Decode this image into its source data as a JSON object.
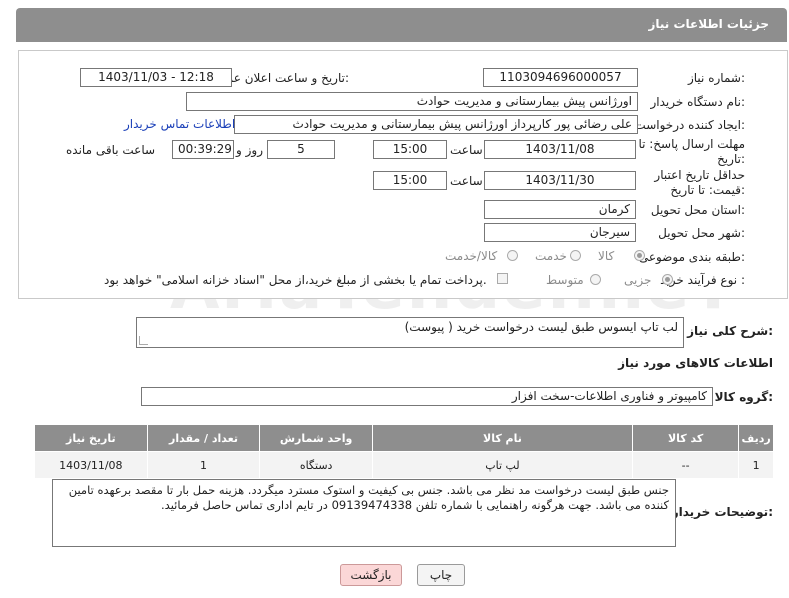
{
  "header": {
    "title": "جزئیات اطلاعات نیاز"
  },
  "watermark": "AriaTender.neT",
  "fields": {
    "need_number": {
      "label": "شماره نیاز:",
      "value": "1103094696000057"
    },
    "announce_datetime": {
      "label": "تاریخ و ساعت اعلان عمومی:",
      "value": "1403/11/03 - 12:18"
    },
    "buyer_org": {
      "label": "نام دستگاه خریدار:",
      "value": "اورژانس پیش بیمارستانی و مدیریت حوادث"
    },
    "requester": {
      "label": "ایجاد کننده درخواست:",
      "value": "علی رضائی پور کارپرداز اورژانس پیش بیمارستانی و مدیریت حوادث"
    },
    "contact_link": "اطلاعات تماس خریدار",
    "reply_deadline": {
      "label": "مهلت ارسال پاسخ: تا تاریخ:",
      "date": "1403/11/08",
      "time_label": "ساعت",
      "time": "15:00",
      "days": "5",
      "days_label": "روز و",
      "remaining": "00:39:29",
      "remaining_label": "ساعت باقی مانده"
    },
    "min_validity": {
      "label": "حداقل تاریخ اعتبار قیمت: تا تاریخ:",
      "date": "1403/11/30",
      "time_label": "ساعت",
      "time": "15:00"
    },
    "province": {
      "label": "استان محل تحویل:",
      "value": "کرمان"
    },
    "city": {
      "label": "شهر محل تحویل:",
      "value": "سیرجان"
    },
    "category": {
      "label": "طبقه بندی موضوعی:",
      "options": [
        "کالا",
        "خدمت",
        "کالا/خدمت"
      ],
      "selected": "کالا"
    },
    "purchase_type": {
      "label": "نوع فرآیند خرید :",
      "options": [
        "جزیی",
        "متوسط"
      ],
      "selected": "جزیی",
      "note": "پرداخت تمام یا بخشی از مبلغ خرید،از محل \"اسناد خزانه اسلامی\" خواهد بود."
    }
  },
  "summary": {
    "label": "شرح کلی نیاز:",
    "value": "لب تاپ ایسوس طبق لیست درخواست خرید ( پیوست)"
  },
  "goods_section": {
    "title": "اطلاعات کالاهای مورد نیاز"
  },
  "goods_group": {
    "label": "گروه کالا:",
    "value": "کامپیوتر و فناوری اطلاعات-سخت افزار"
  },
  "table": {
    "headers": [
      "ردیف",
      "کد کالا",
      "نام کالا",
      "واحد شمارش",
      "تعداد / مقدار",
      "تاریخ نیاز"
    ],
    "rows": [
      [
        "1",
        "--",
        "لپ تاپ",
        "دستگاه",
        "1",
        "1403/11/08"
      ]
    ]
  },
  "buyer_notes": {
    "label": "توضیحات خریدار:",
    "value": "جنس طبق لیست درخواست مد نظر می باشد. جنس بی کیفیت و استوک مسترد میگردد. هزینه حمل بار تا مقصد برعهده تامین کننده می باشد. جهت هرگونه راهنمایی با شماره تلفن 09139474338 در تایم اداری تماس حاصل فرمائید."
  },
  "buttons": {
    "print": "چاپ",
    "back": "بازگشت"
  }
}
